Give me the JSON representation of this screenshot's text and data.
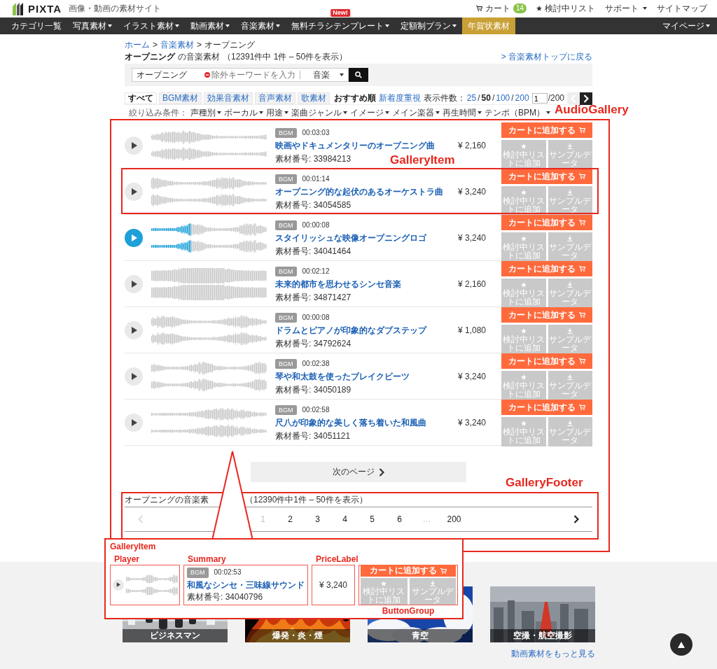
{
  "header": {
    "logo": "PIXTA",
    "tagline": "画像・動画の素材サイト",
    "links": [
      {
        "kind": "cart",
        "label": "カート",
        "badge": "14"
      },
      {
        "kind": "star",
        "label": "検討中リスト"
      },
      {
        "kind": "dropdown",
        "label": "サポート"
      },
      {
        "kind": "plain",
        "label": "サイトマップ"
      }
    ]
  },
  "nav": {
    "items": [
      {
        "label": "カテゴリ一覧",
        "dropdown": false,
        "highlighted": false
      },
      {
        "label": "写真素材",
        "dropdown": true,
        "highlighted": false
      },
      {
        "label": "イラスト素材",
        "dropdown": true,
        "highlighted": false
      },
      {
        "label": "動画素材",
        "dropdown": true,
        "highlighted": false
      },
      {
        "label": "音楽素材",
        "dropdown": true,
        "highlighted": false
      },
      {
        "label": "無料チラシテンプレート",
        "dropdown": true,
        "highlighted": false,
        "badge": "New!"
      },
      {
        "label": "定額制プラン",
        "dropdown": true,
        "highlighted": false
      },
      {
        "label": "年賀状素材",
        "dropdown": false,
        "highlighted": true
      }
    ],
    "right": {
      "label": "マイページ",
      "dropdown": true
    }
  },
  "breadcrumb": {
    "separator": ">",
    "items": [
      {
        "label": "ホーム",
        "link": true
      },
      {
        "label": "音楽素材",
        "link": true
      },
      {
        "label": "オープニング",
        "link": false
      }
    ]
  },
  "title": {
    "keyword": "オープニング",
    "suffix": "の音楽素材",
    "count": "（12391件中 1件 – 50件を表示）",
    "back_link": "> 音楽素材トップに戻る"
  },
  "search": {
    "value": "オープニング",
    "exclude_placeholder": "除外キーワードを入力",
    "category": "音楽"
  },
  "tabs": [
    {
      "label": "すべて",
      "selected": true
    },
    {
      "label": "BGM素材",
      "selected": false
    },
    {
      "label": "効果音素材",
      "selected": false
    },
    {
      "label": "音声素材",
      "selected": false
    },
    {
      "label": "歌素材",
      "selected": false
    }
  ],
  "sort": [
    {
      "label": "おすすめ順",
      "selected": true
    },
    {
      "label": "新着度重視",
      "selected": false
    }
  ],
  "per_page": {
    "label": "表示件数：",
    "separator": "/",
    "options": [
      {
        "label": "25",
        "selected": false
      },
      {
        "label": "50",
        "selected": true
      },
      {
        "label": "100",
        "selected": false
      },
      {
        "label": "200",
        "selected": false
      }
    ]
  },
  "page_jump": {
    "value": "1",
    "total": "/200",
    "prev_disabled": true
  },
  "filters": {
    "label": "絞り込み条件：",
    "items": [
      "声種別",
      "ボーカル",
      "用途",
      "楽曲ジャンル",
      "イメージ",
      "メイン楽器",
      "再生時間",
      "テンポ（BPM）"
    ]
  },
  "items": [
    {
      "badge": "BGM",
      "duration": "00:03:03",
      "title": "映画やドキュメンタリーのオープニング曲",
      "id": "素材番号: 33984213",
      "price": "¥ 2,160",
      "playing": false,
      "actions": [
        "カートに追加する",
        "検討中リストに追加",
        "サンプルデータ"
      ]
    },
    {
      "badge": "BGM",
      "duration": "00:01:14",
      "title": "オープニング的な起伏のあるオーケストラ曲",
      "id": "素材番号: 34054585",
      "price": "¥ 3,240",
      "playing": false,
      "actions": [
        "カートに追加する",
        "検討中リストに追加",
        "サンプルデータ"
      ]
    },
    {
      "badge": "BGM",
      "duration": "00:00:08",
      "title": "スタイリッシュな映像オープニングロゴ",
      "id": "素材番号: 34041464",
      "price": "¥ 3,240",
      "playing": true,
      "actions": [
        "カートに追加する",
        "検討中リストに追加",
        "サンプルデータ"
      ]
    },
    {
      "badge": "BGM",
      "duration": "00:02:12",
      "title": "未来的都市を思わせるシンセ音楽",
      "id": "素材番号: 34871427",
      "price": "¥ 2,160",
      "playing": false,
      "actions": [
        "カートに追加する",
        "検討中リストに追加",
        "サンプルデータ"
      ]
    },
    {
      "badge": "BGM",
      "duration": "00:00:08",
      "title": "ドラムとピアノが印象的なダブステップ",
      "id": "素材番号: 34792624",
      "price": "¥ 1,080",
      "playing": false,
      "actions": [
        "カートに追加する",
        "検討中リストに追加",
        "サンプルデータ"
      ]
    },
    {
      "badge": "BGM",
      "duration": "00:02:38",
      "title": "琴や和太鼓を使ったブレイクビーツ",
      "id": "素材番号: 34050189",
      "price": "¥ 3,240",
      "playing": false,
      "actions": [
        "カートに追加する",
        "検討中リストに追加",
        "サンプルデータ"
      ]
    },
    {
      "badge": "BGM",
      "duration": "00:02:58",
      "title": "尺八が印象的な美しく落ち着いた和風曲",
      "id": "素材番号: 34051121",
      "price": "¥ 3,240",
      "playing": false,
      "actions": [
        "カートに追加する",
        "検討中リストに追加",
        "サンプルデータ"
      ]
    }
  ],
  "next_page": "次のページ",
  "footer": {
    "summary_start": "オープニングの音楽素",
    "summary_end": "（12390件中1件 – 50件を表示）",
    "prev_disabled": true,
    "pages": [
      {
        "kind": "page",
        "label": "1",
        "selected": true
      },
      {
        "kind": "page",
        "label": "2",
        "selected": false
      },
      {
        "kind": "page",
        "label": "3",
        "selected": false
      },
      {
        "kind": "page",
        "label": "4",
        "selected": false
      },
      {
        "kind": "page",
        "label": "5",
        "selected": false
      },
      {
        "kind": "page",
        "label": "6",
        "selected": false
      },
      {
        "kind": "ellipsis",
        "label": "…",
        "selected": false
      },
      {
        "kind": "page",
        "label": "200",
        "selected": false
      }
    ]
  },
  "annotations": [
    {
      "label": "AudioGallery"
    },
    {
      "label": "GalleryItem"
    },
    {
      "label": "GalleryFooter"
    }
  ],
  "callout": {
    "title": "GalleryItem",
    "parts": [
      "Player",
      "Summary",
      "PriceLabel",
      "ButtonGroup"
    ],
    "item": {
      "badge": "BGM",
      "duration": "00:02:53",
      "title": "和風なシンセ・三味線サウンド",
      "id": "素材番号: 34040796",
      "price": "¥ 3,240",
      "actions": [
        "カートに追加する",
        "検討中リストに追加",
        "サンプルデータ"
      ]
    }
  },
  "related": {
    "tiles": [
      {
        "caption": "ビジネスマン",
        "kind": "people"
      },
      {
        "caption": "爆発・炎・煙",
        "kind": "fire"
      },
      {
        "caption": "青空",
        "kind": "sky"
      },
      {
        "caption": "空撮・航空撮影",
        "kind": "city"
      }
    ],
    "more_link": "動画素材をもっと見る"
  }
}
